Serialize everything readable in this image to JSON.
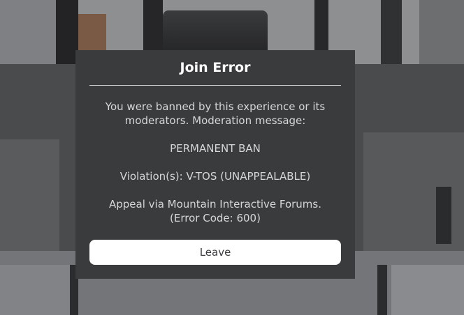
{
  "dialog": {
    "title": "Join Error",
    "message_line1": "You were banned by this experience or its",
    "message_line2": "moderators. Moderation message:",
    "ban_text": "PERMANENT BAN",
    "violations": "Violation(s): V-TOS (UNAPPEALABLE)",
    "appeal_line1": "Appeal via Mountain Interactive Forums.",
    "appeal_line2": "(Error Code: 600)",
    "leave_label": "Leave"
  },
  "colors": {
    "dialog_background": "#393b3d",
    "title_text": "#ffffff",
    "body_text": "#d6d7d8",
    "button_background": "#ffffff",
    "button_text": "#393b3d"
  }
}
